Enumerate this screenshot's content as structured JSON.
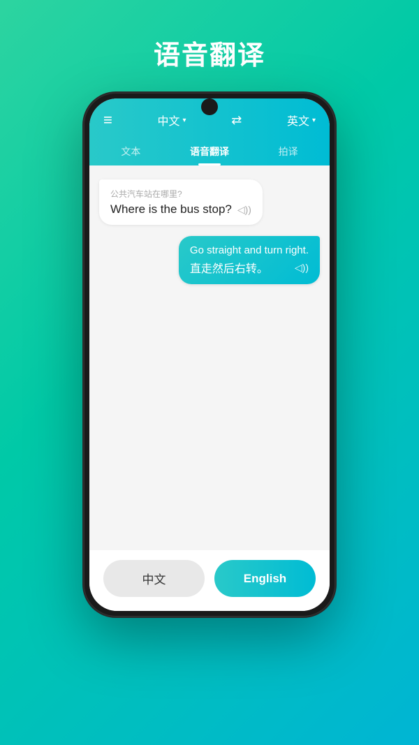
{
  "page": {
    "title": "语音翻译",
    "background_gradient_start": "#2dd4a0",
    "background_gradient_end": "#00b5d4"
  },
  "header": {
    "menu_icon": "≡",
    "lang_left": "中文",
    "swap_icon": "⇄",
    "lang_right": "英文",
    "chevron": "▾"
  },
  "tabs": [
    {
      "label": "文本",
      "active": false
    },
    {
      "label": "语音翻译",
      "active": true
    },
    {
      "label": "拍译",
      "active": false
    }
  ],
  "messages": [
    {
      "side": "left",
      "sub_text": "公共汽车站在哪里?",
      "main_text": "Where is the bus stop?",
      "sound": "◁))"
    },
    {
      "side": "right",
      "main_text": "Go straight and turn right.",
      "sub_text": "直走然后右转。",
      "sound": "◁))"
    }
  ],
  "bottom_buttons": {
    "chinese_label": "中文",
    "english_label": "English"
  }
}
